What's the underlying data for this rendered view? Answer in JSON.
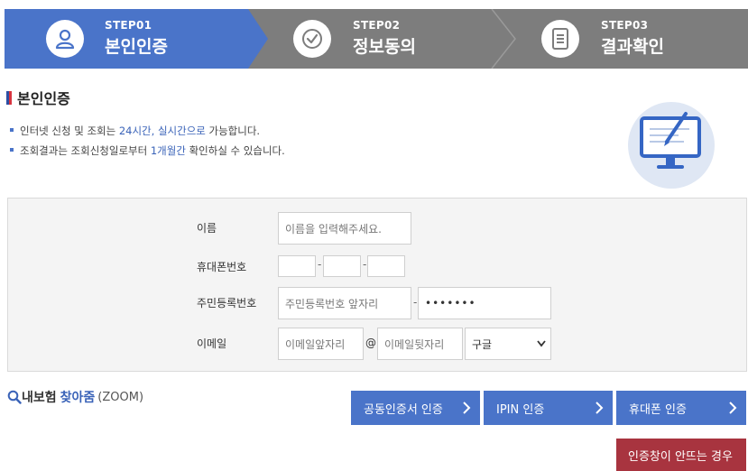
{
  "steps": [
    {
      "no": "STEP01",
      "name": "본인인증",
      "icon": "user-icon",
      "active": true
    },
    {
      "no": "STEP02",
      "name": "정보동의",
      "icon": "check-circle-icon",
      "active": false
    },
    {
      "no": "STEP03",
      "name": "결과확인",
      "icon": "document-icon",
      "active": false
    }
  ],
  "page_title": "본인인증",
  "notes": {
    "n1": {
      "a": "인터넷 신청 및 조회는 ",
      "b": "24시간, 실시간으로",
      "c": " 가능합니다."
    },
    "n2": {
      "a": "조회결과는 조회신청일로부터 ",
      "b": "1개월간",
      "c": " 확인하실 수 있습니다."
    }
  },
  "form": {
    "name_label": "이름",
    "name_placeholder": "이름을 입력해주세요.",
    "phone_label": "휴대폰번호",
    "phone_sep": "-",
    "rrn_label": "주민등록번호",
    "rrn_front_placeholder": "주민등록번호 앞자리",
    "rrn_sep": "-",
    "rrn_back_value": "•••••••",
    "email_label": "이메일",
    "email_front_placeholder": "이메일앞자리",
    "email_at": "@",
    "email_back_placeholder": "이메일뒷자리",
    "email_domain_selected": "구글"
  },
  "zoom": {
    "a": "내보험",
    "b": "찾아줌",
    "c": "(ZOOM)"
  },
  "buttons": {
    "cert": "공동인증서 인증",
    "ipin": "IPIN 인증",
    "phone": "휴대폰 인증",
    "popup_help": "인증창이 안뜨는 경우"
  },
  "colors": {
    "primary": "#4a74c9",
    "inactive": "#7d7d7d",
    "danger": "#a8343f"
  }
}
